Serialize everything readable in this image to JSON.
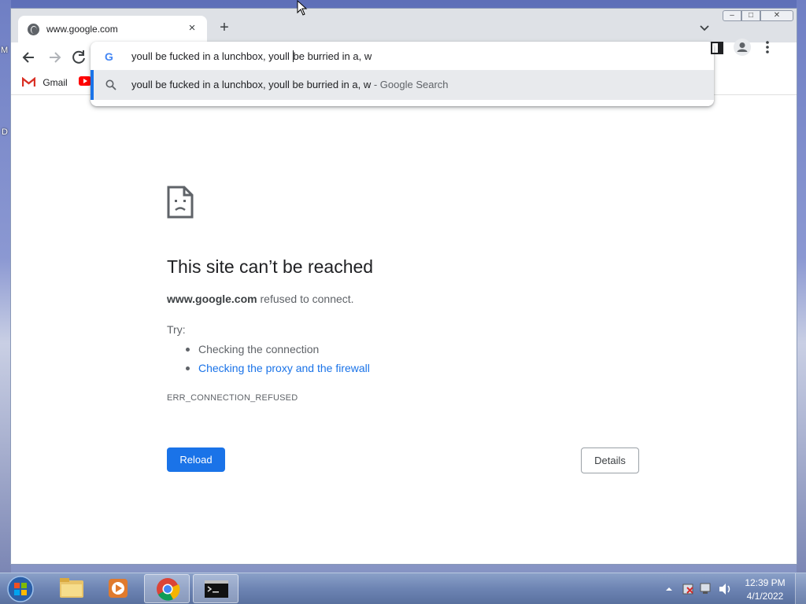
{
  "desktop": {
    "left_fragments": [
      "M",
      "D"
    ]
  },
  "browser": {
    "tab": {
      "title": "www.google.com",
      "close_symbol": "×"
    },
    "new_tab_symbol": "+",
    "window_controls": {
      "minimize": "–",
      "maximize": "□",
      "close": "✕"
    },
    "bookmarks": [
      {
        "label": "Gmail",
        "icon": "gmail-icon"
      },
      {
        "label": "",
        "icon": "youtube-icon"
      }
    ],
    "omnibox": {
      "input_value": "youll be fucked in a lunchbox, youll be burried in a, w",
      "suggestion_text": "youll be fucked in a lunchbox, youll be burried in a, w",
      "suggestion_suffix": " - Google Search",
      "logo_letter": "G"
    }
  },
  "error_page": {
    "title": "This site can’t be reached",
    "host": "www.google.com",
    "description": " refused to connect.",
    "try_label": "Try:",
    "suggestions": [
      "Checking the connection",
      "Checking the proxy and the firewall"
    ],
    "error_code": "ERR_CONNECTION_REFUSED",
    "reload_label": "Reload",
    "details_label": "Details"
  },
  "taskbar": {
    "items": [
      "windows-explorer",
      "media-player",
      "chrome",
      "command-prompt"
    ],
    "active_item": "chrome",
    "clock_time": "12:39 PM",
    "clock_date": "4/1/2022"
  },
  "colors": {
    "accent": "#1a73e8",
    "tabstrip": "#dee1e6",
    "suggestion_highlight": "#e8eaed"
  }
}
